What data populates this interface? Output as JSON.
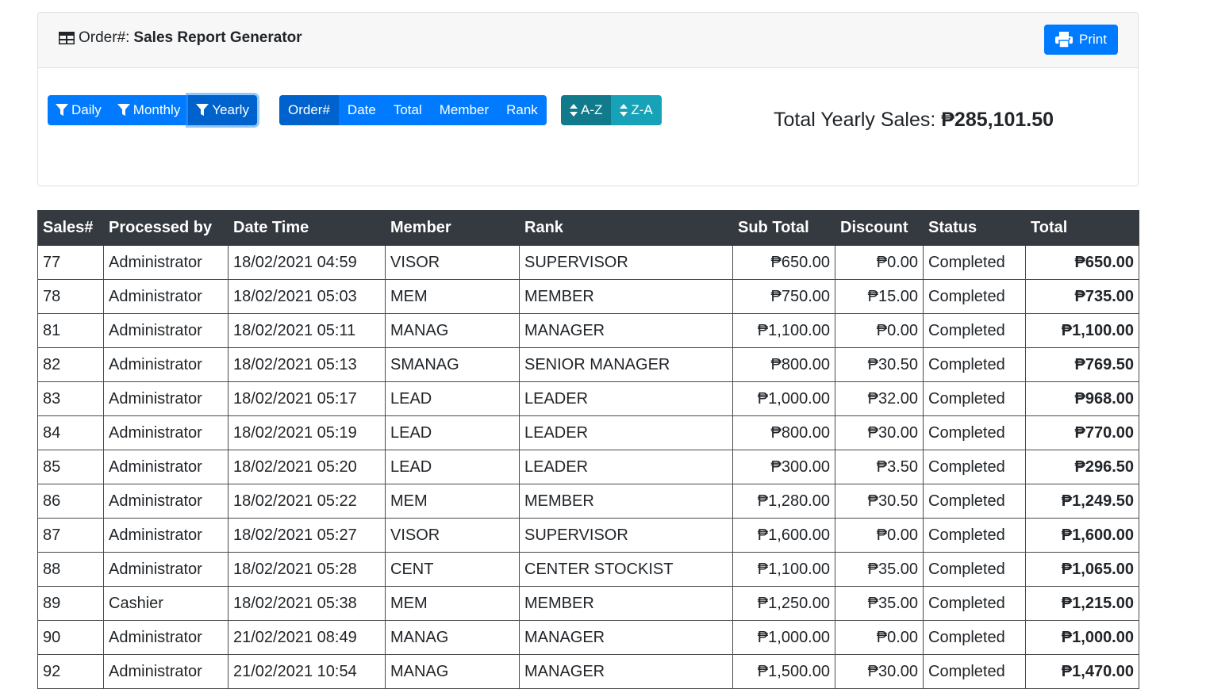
{
  "header": {
    "prefix": "Order#:",
    "title": "Sales Report Generator",
    "print_label": "Print"
  },
  "filters": {
    "daily": "Daily",
    "monthly": "Monthly",
    "yearly": "Yearly",
    "active": "Yearly"
  },
  "sort_fields": [
    "Order#",
    "Date",
    "Total",
    "Member",
    "Rank"
  ],
  "sort_order": {
    "asc": "A-Z",
    "desc": "Z-A"
  },
  "summary": {
    "label": "Total Yearly Sales:",
    "value": "₱285,101.50"
  },
  "colors": {
    "primary": "#007bff",
    "primary_active": "#0062cc",
    "info": "#17a2b8",
    "info_active": "#117a8b",
    "table_header": "#343a40"
  },
  "table": {
    "columns": [
      "Sales#",
      "Processed by",
      "Date Time",
      "Member",
      "Rank",
      "Sub Total",
      "Discount",
      "Status",
      "Total"
    ],
    "rows": [
      [
        "77",
        "Administrator",
        "18/02/2021 04:59",
        "VISOR",
        "SUPERVISOR",
        "₱650.00",
        "₱0.00",
        "Completed",
        "₱650.00"
      ],
      [
        "78",
        "Administrator",
        "18/02/2021 05:03",
        "MEM",
        "MEMBER",
        "₱750.00",
        "₱15.00",
        "Completed",
        "₱735.00"
      ],
      [
        "81",
        "Administrator",
        "18/02/2021 05:11",
        "MANAG",
        "MANAGER",
        "₱1,100.00",
        "₱0.00",
        "Completed",
        "₱1,100.00"
      ],
      [
        "82",
        "Administrator",
        "18/02/2021 05:13",
        "SMANAG",
        "SENIOR MANAGER",
        "₱800.00",
        "₱30.50",
        "Completed",
        "₱769.50"
      ],
      [
        "83",
        "Administrator",
        "18/02/2021 05:17",
        "LEAD",
        "LEADER",
        "₱1,000.00",
        "₱32.00",
        "Completed",
        "₱968.00"
      ],
      [
        "84",
        "Administrator",
        "18/02/2021 05:19",
        "LEAD",
        "LEADER",
        "₱800.00",
        "₱30.00",
        "Completed",
        "₱770.00"
      ],
      [
        "85",
        "Administrator",
        "18/02/2021 05:20",
        "LEAD",
        "LEADER",
        "₱300.00",
        "₱3.50",
        "Completed",
        "₱296.50"
      ],
      [
        "86",
        "Administrator",
        "18/02/2021 05:22",
        "MEM",
        "MEMBER",
        "₱1,280.00",
        "₱30.50",
        "Completed",
        "₱1,249.50"
      ],
      [
        "87",
        "Administrator",
        "18/02/2021 05:27",
        "VISOR",
        "SUPERVISOR",
        "₱1,600.00",
        "₱0.00",
        "Completed",
        "₱1,600.00"
      ],
      [
        "88",
        "Administrator",
        "18/02/2021 05:28",
        "CENT",
        "CENTER STOCKIST",
        "₱1,100.00",
        "₱35.00",
        "Completed",
        "₱1,065.00"
      ],
      [
        "89",
        "Cashier",
        "18/02/2021 05:38",
        "MEM",
        "MEMBER",
        "₱1,250.00",
        "₱35.00",
        "Completed",
        "₱1,215.00"
      ],
      [
        "90",
        "Administrator",
        "21/02/2021 08:49",
        "MANAG",
        "MANAGER",
        "₱1,000.00",
        "₱0.00",
        "Completed",
        "₱1,000.00"
      ],
      [
        "92",
        "Administrator",
        "21/02/2021 10:54",
        "MANAG",
        "MANAGER",
        "₱1,500.00",
        "₱30.00",
        "Completed",
        "₱1,470.00"
      ]
    ]
  }
}
